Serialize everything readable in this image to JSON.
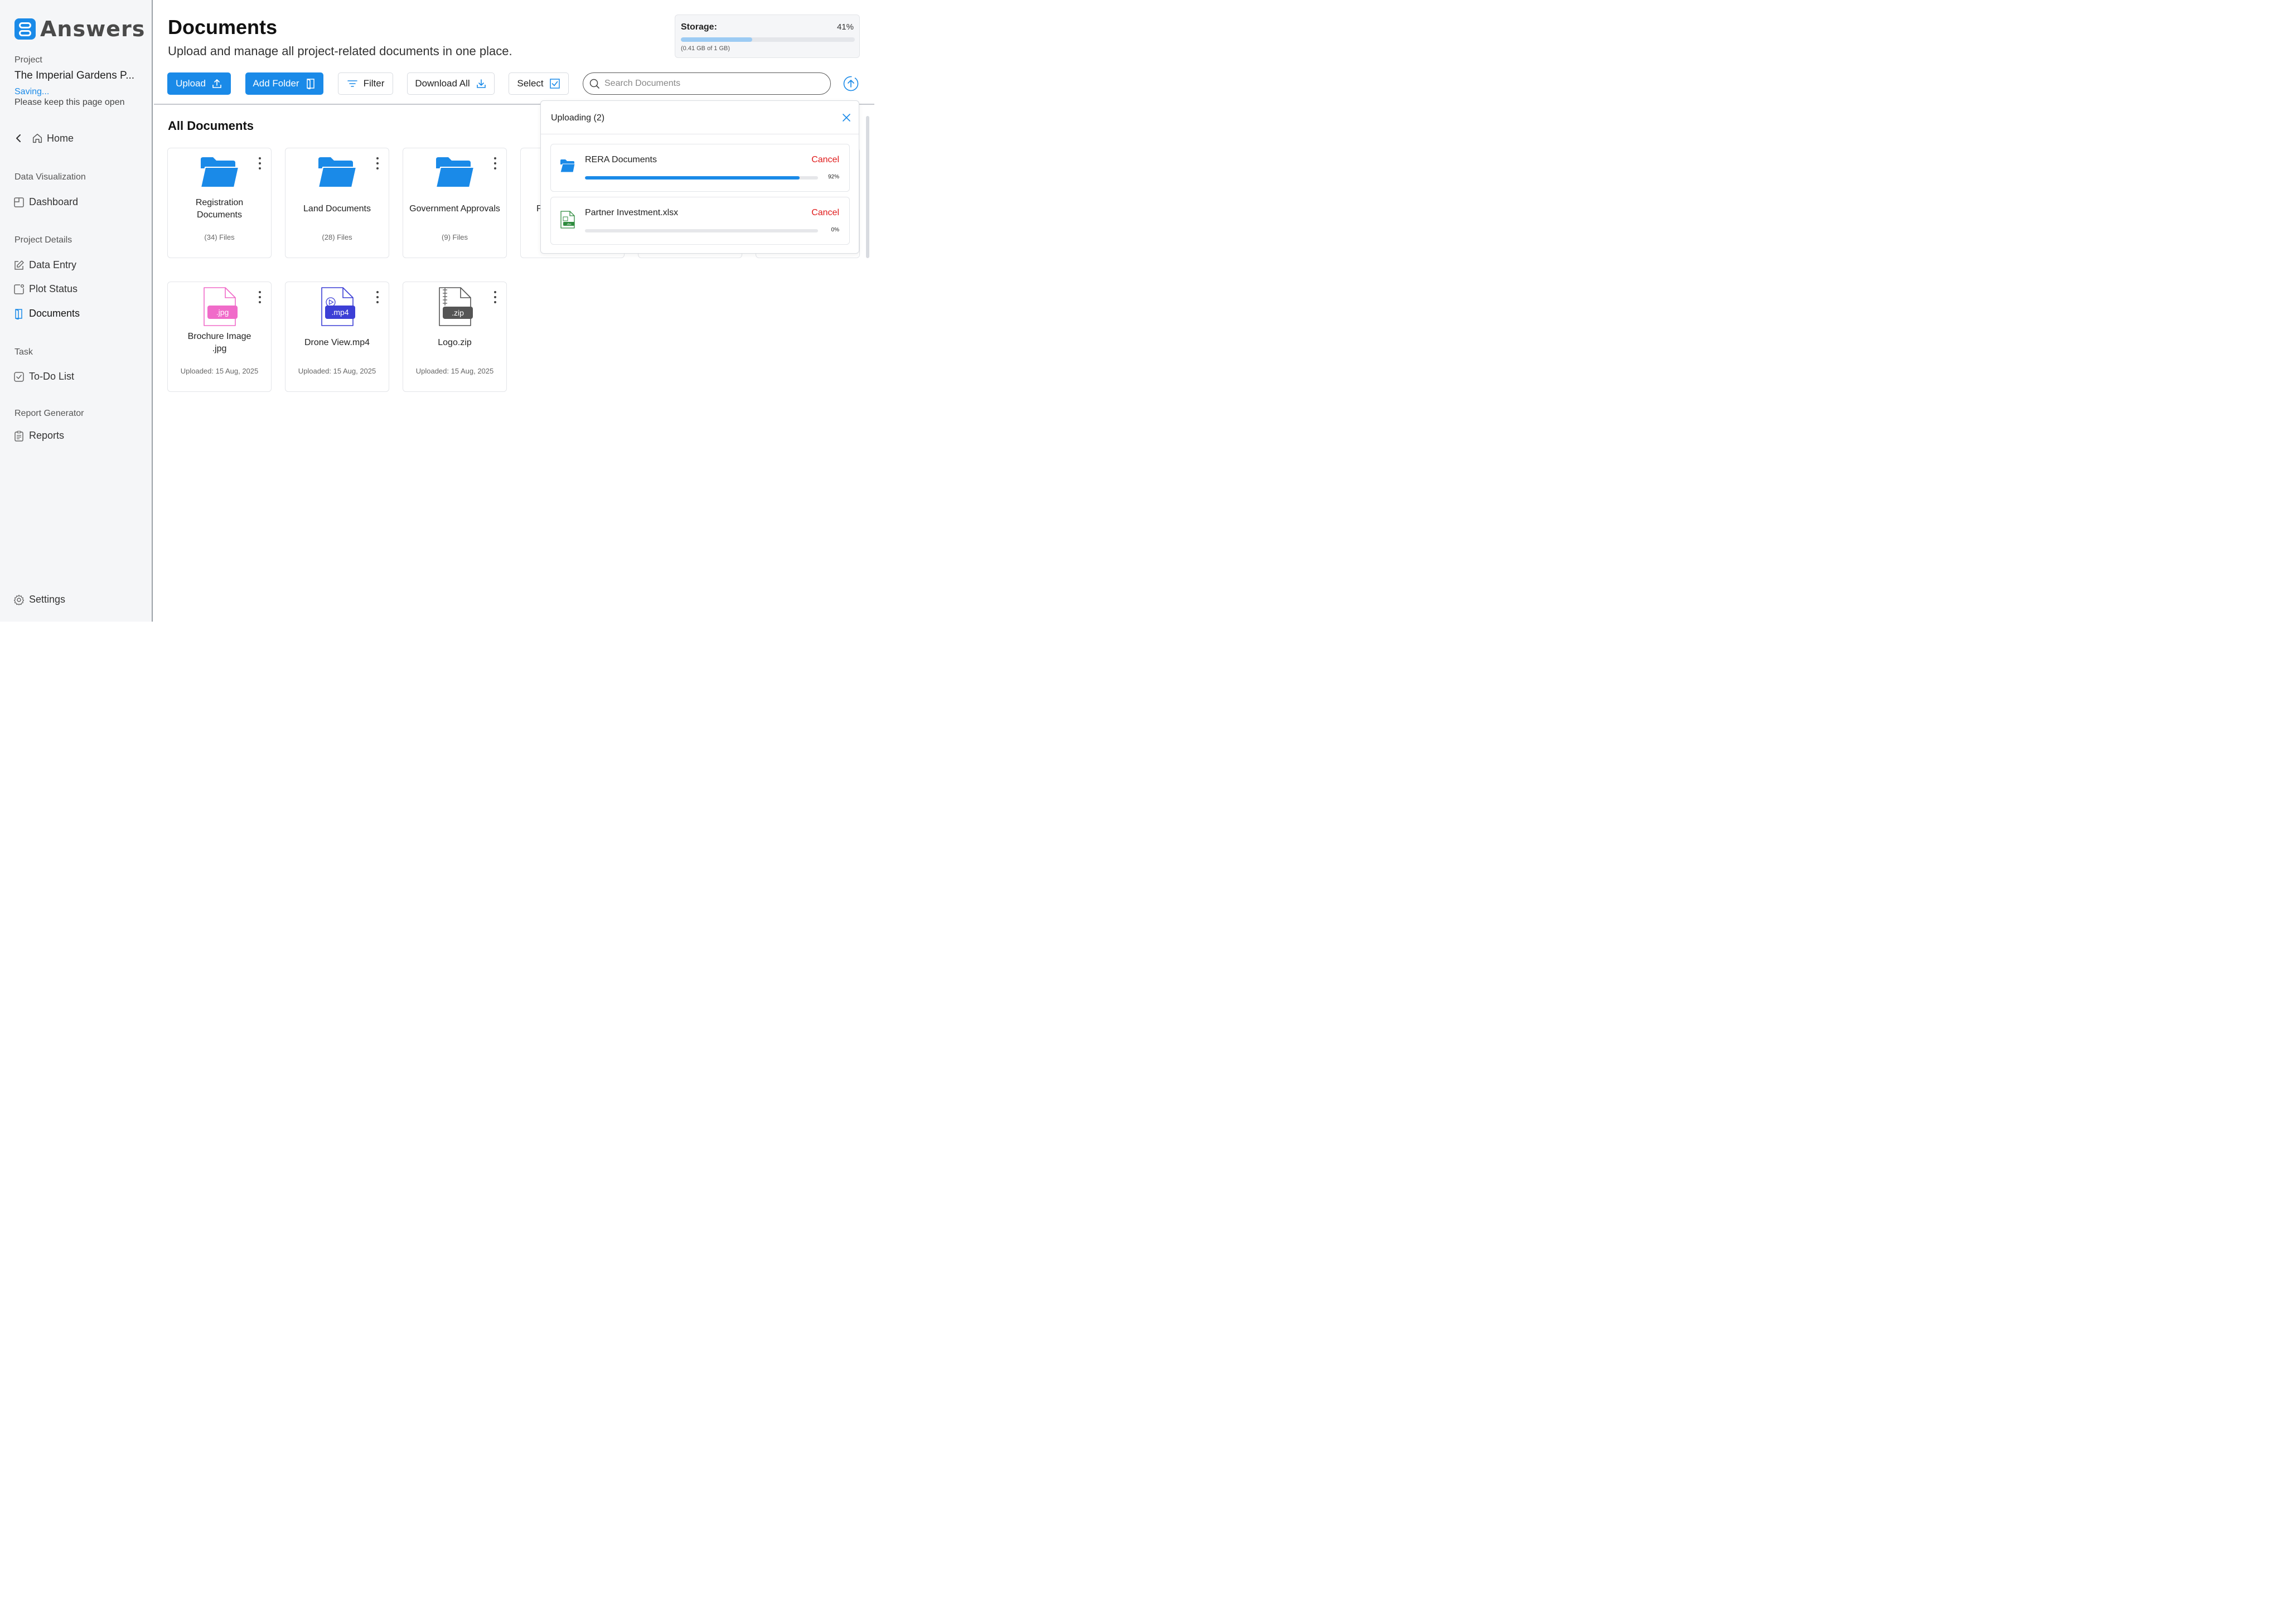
{
  "app": {
    "name": "Answers"
  },
  "sidebar": {
    "project_label": "Project",
    "project_name": "The Imperial Gardens P...",
    "saving": "Saving...",
    "keep_open": "Please keep this page open",
    "home": "Home",
    "sections": {
      "data_visualization": "Data Visualization",
      "project_details": "Project Details",
      "task": "Task",
      "report_generator": "Report Generator"
    },
    "items": {
      "dashboard": "Dashboard",
      "data_entry": "Data Entry",
      "plot_status": "Plot Status",
      "documents": "Documents",
      "todo": "To-Do List",
      "reports": "Reports",
      "settings": "Settings"
    }
  },
  "header": {
    "title": "Documents",
    "subtitle": "Upload and manage all project-related documents in one place."
  },
  "storage": {
    "label": "Storage:",
    "percent_text": "41%",
    "fraction": 0.41,
    "detail": "(0.41 GB of 1 GB)"
  },
  "toolbar": {
    "upload": "Upload",
    "add_folder": "Add Folder",
    "filter": "Filter",
    "download_all": "Download All",
    "select": "Select",
    "search_placeholder": "Search Documents"
  },
  "main": {
    "section_title": "All Documents",
    "folders": [
      {
        "name": "Registration Documents",
        "meta": "(34) Files"
      },
      {
        "name": "Land Documents",
        "meta": "(28) Files"
      },
      {
        "name": "Government Approvals",
        "meta": "(9) Files"
      },
      {
        "name": "P",
        "meta": ""
      }
    ],
    "files": [
      {
        "name": "Brochure Image .jpg",
        "ext": ".jpg",
        "meta": "Uploaded: 15 Aug, 2025"
      },
      {
        "name": "Drone View.mp4",
        "ext": ".mp4",
        "meta": "Uploaded: 15 Aug, 2025"
      },
      {
        "name": "Logo.zip",
        "ext": ".zip",
        "meta": "Uploaded: 15 Aug, 2025"
      }
    ]
  },
  "upload_panel": {
    "title": "Uploading (2)",
    "items": [
      {
        "name": "RERA Documents",
        "cancel": "Cancel",
        "percent_text": "92%",
        "fraction": 0.92
      },
      {
        "name": "Partner Investment.xlsx",
        "cancel": "Cancel",
        "percent_text": "0%",
        "fraction": 0,
        "ext": ".xlsx"
      }
    ]
  },
  "colors": {
    "accent": "#1a8ae8",
    "danger": "#e01b1b",
    "jpg": "#f06bc9",
    "mp4": "#3c3fd6",
    "zip": "#555555",
    "xlsx": "#2e8b3e"
  }
}
